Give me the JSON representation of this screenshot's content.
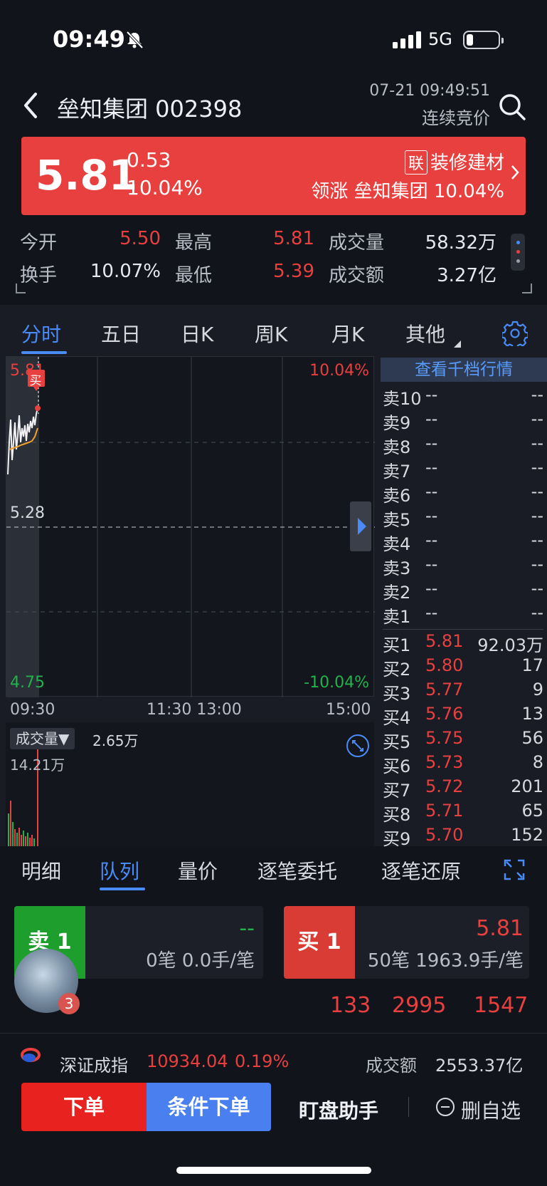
{
  "status": {
    "time": "09:49",
    "network": "5G"
  },
  "header": {
    "title": "垒知集团 002398",
    "datetime": "07-21 09:49:51",
    "trade_status": "连续竞价"
  },
  "quote": {
    "price": "5.81",
    "change": "0.53",
    "change_pct": "10.04%",
    "sector_tag": "联",
    "sector": "装修建材",
    "leader": "领涨 垒知集团 10.04%"
  },
  "stats": {
    "open_label": "今开",
    "open": "5.50",
    "high_label": "最高",
    "high": "5.81",
    "volume_label": "成交量",
    "volume": "58.32万",
    "turnover_label": "换手",
    "turnover": "10.07%",
    "low_label": "最低",
    "low": "5.39",
    "amount_label": "成交额",
    "amount": "3.27亿"
  },
  "chart_tabs": [
    "分时",
    "五日",
    "日K",
    "周K",
    "月K",
    "其他"
  ],
  "chart": {
    "price_top": "5.81",
    "pct_top": "10.04%",
    "price_mid": "5.28",
    "price_bottom": "4.75",
    "pct_bottom": "-10.04%",
    "buy_marker": "买",
    "times": [
      "09:30",
      "11:30 13:00",
      "15:00"
    ],
    "volume_label": "成交量▼",
    "volume_value": "2.65万",
    "volume_max": "14.21万"
  },
  "orderbook": {
    "header": "查看千档行情",
    "asks": [
      {
        "label": "卖10",
        "price": "--",
        "vol": "--"
      },
      {
        "label": "卖9",
        "price": "--",
        "vol": "--"
      },
      {
        "label": "卖8",
        "price": "--",
        "vol": "--"
      },
      {
        "label": "卖7",
        "price": "--",
        "vol": "--"
      },
      {
        "label": "卖6",
        "price": "--",
        "vol": "--"
      },
      {
        "label": "卖5",
        "price": "--",
        "vol": "--"
      },
      {
        "label": "卖4",
        "price": "--",
        "vol": "--"
      },
      {
        "label": "卖3",
        "price": "--",
        "vol": "--"
      },
      {
        "label": "卖2",
        "price": "--",
        "vol": "--"
      },
      {
        "label": "卖1",
        "price": "--",
        "vol": "--"
      }
    ],
    "bids": [
      {
        "label": "买1",
        "price": "5.81",
        "vol": "92.03万"
      },
      {
        "label": "买2",
        "price": "5.80",
        "vol": "17"
      },
      {
        "label": "买3",
        "price": "5.77",
        "vol": "9"
      },
      {
        "label": "买4",
        "price": "5.76",
        "vol": "13"
      },
      {
        "label": "买5",
        "price": "5.75",
        "vol": "56"
      },
      {
        "label": "买6",
        "price": "5.73",
        "vol": "8"
      },
      {
        "label": "买7",
        "price": "5.72",
        "vol": "201"
      },
      {
        "label": "买8",
        "price": "5.71",
        "vol": "65"
      },
      {
        "label": "买9",
        "price": "5.70",
        "vol": "152"
      }
    ]
  },
  "detail_tabs": [
    "明细",
    "队列",
    "量价",
    "逐笔委托",
    "逐笔还原"
  ],
  "queue": {
    "sell_label": "卖 1",
    "sell_price": "--",
    "sell_info": "0笔 0.0手/笔",
    "buy_label": "买 1",
    "buy_price": "5.81",
    "buy_info": "50笔 1963.9手/笔",
    "buy_orders": [
      "133",
      "2995",
      "1547"
    ],
    "avatar_badge": "3"
  },
  "index": {
    "name": "深证成指",
    "value": "10934.04",
    "pct": "0.19%",
    "amount_label": "成交额",
    "amount": "2553.37亿"
  },
  "bottom": {
    "order": "下单",
    "conditional": "条件下单",
    "helper": "盯盘助手",
    "remove": "删自选"
  },
  "colors": {
    "up": "#e8403f",
    "down": "#22b24c",
    "accent": "#4a8cf7"
  }
}
